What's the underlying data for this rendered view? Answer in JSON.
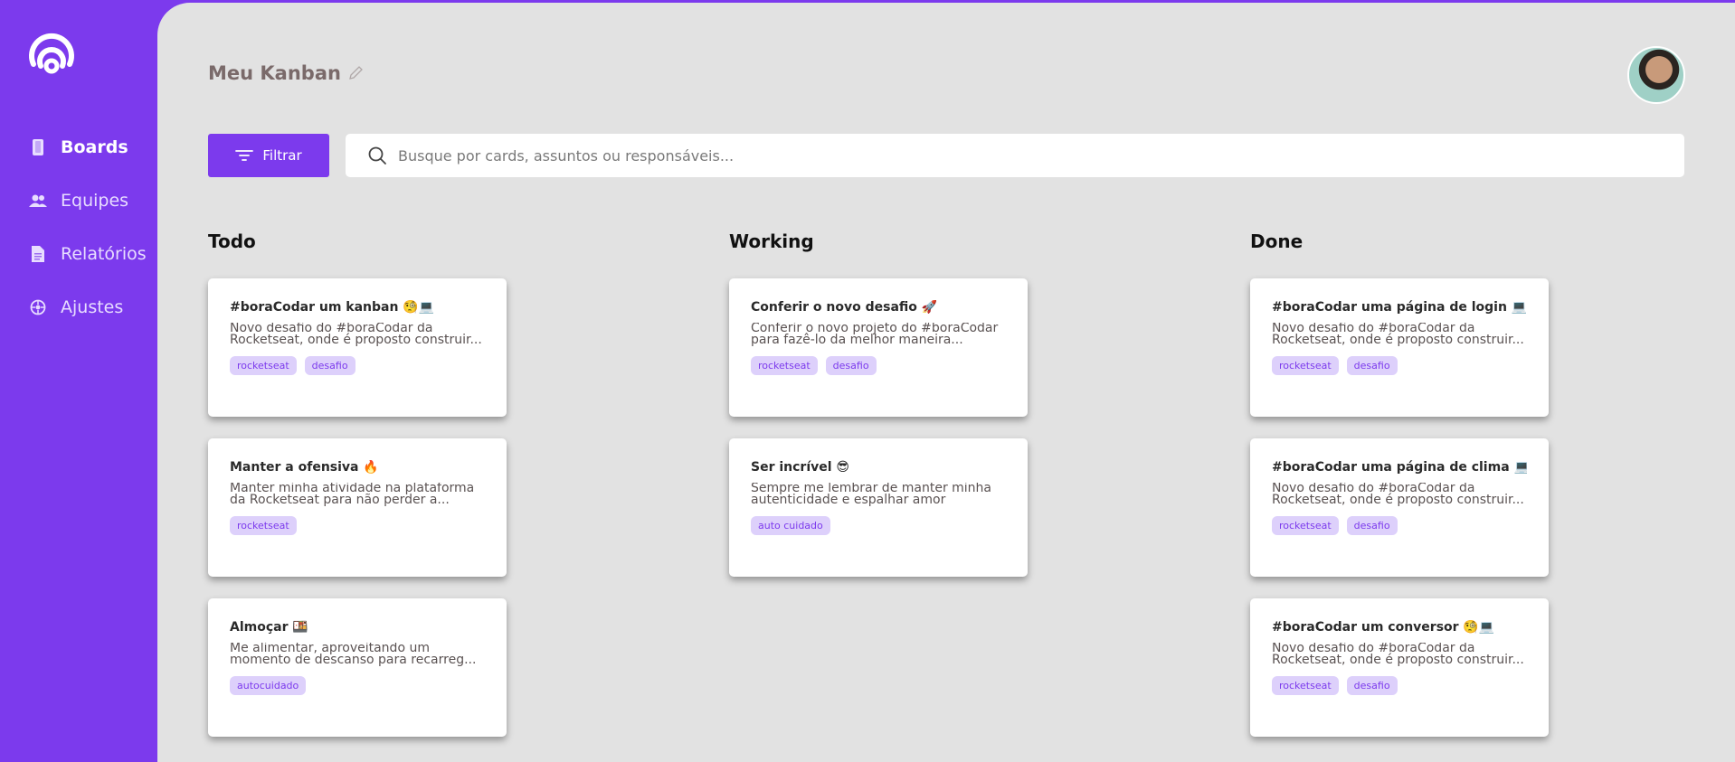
{
  "sidebar": {
    "items": [
      {
        "label": "Boards",
        "icon": "phone-icon",
        "active": true
      },
      {
        "label": "Equipes",
        "icon": "users-icon",
        "active": false
      },
      {
        "label": "Relatórios",
        "icon": "document-icon",
        "active": false
      },
      {
        "label": "Ajustes",
        "icon": "settings-icon",
        "active": false
      }
    ]
  },
  "header": {
    "title": "Meu Kanban",
    "filter_label": "Filtrar",
    "search_placeholder": "Busque por cards, assuntos ou responsáveis..."
  },
  "columns": [
    {
      "title": "Todo",
      "cards": [
        {
          "title": "#boraCodar um kanban 🧐💻",
          "desc": "Novo desafio do #boraCodar da Rocketseat, onde é proposto construir...",
          "tags": [
            "rocketseat",
            "desafio"
          ]
        },
        {
          "title": "Manter a ofensiva 🔥",
          "desc": "Manter minha atividade na plataforma da Rocketseat para não perder a...",
          "tags": [
            "rocketseat"
          ]
        },
        {
          "title": "Almoçar 🍱",
          "desc": "Me alimentar, aproveitando um momento de descanso para recarreg...",
          "tags": [
            "autocuidado"
          ]
        }
      ]
    },
    {
      "title": "Working",
      "cards": [
        {
          "title": "Conferir o novo desafio 🚀",
          "desc": "Conferir o novo projeto do #boraCodar para fazê-lo da melhor maneira...",
          "tags": [
            "rocketseat",
            "desafio"
          ]
        },
        {
          "title": "Ser incrível 😎",
          "desc": "Sempre me lembrar de manter minha autenticidade e espalhar amor",
          "tags": [
            "auto cuidado"
          ]
        }
      ]
    },
    {
      "title": "Done",
      "cards": [
        {
          "title": "#boraCodar uma página de login 💻",
          "desc": "Novo desafio do #boraCodar da Rocketseat, onde é proposto construir...",
          "tags": [
            "rocketseat",
            "desafio"
          ]
        },
        {
          "title": "#boraCodar uma página de clima 💻",
          "desc": "Novo desafio do #boraCodar da Rocketseat, onde é proposto construir...",
          "tags": [
            "rocketseat",
            "desafio"
          ]
        },
        {
          "title": "#boraCodar um conversor 🧐💻",
          "desc": "Novo desafio do #boraCodar da Rocketseat, onde é proposto construir...",
          "tags": [
            "rocketseat",
            "desafio"
          ]
        }
      ]
    }
  ],
  "colors": {
    "accent": "#7c3aed",
    "background": "#e2e2e2",
    "tag_bg": "#ddd0fb"
  }
}
